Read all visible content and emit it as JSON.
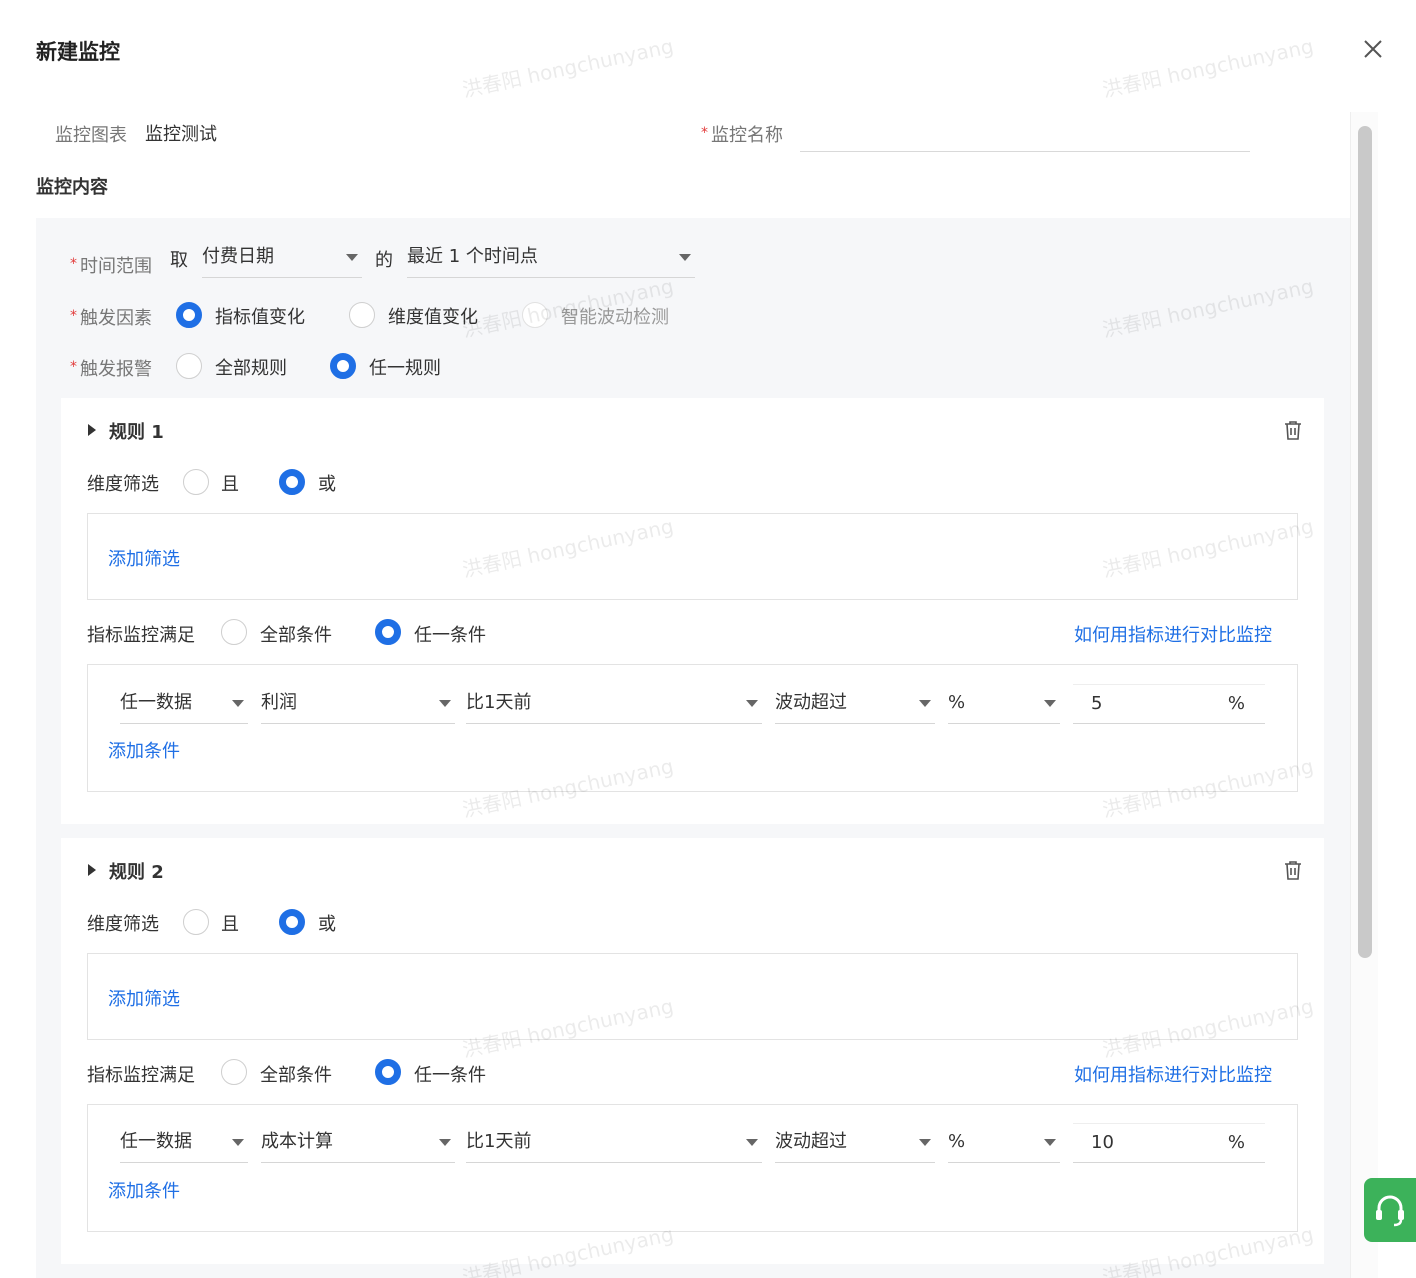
{
  "dialog": {
    "title": "新建监控"
  },
  "form": {
    "chart_label": "监控图表",
    "chart_value": "监控测试",
    "name_label": "监控名称",
    "name_value": "",
    "section_title": "监控内容",
    "time_range_label": "时间范围",
    "time_take": "取",
    "date_field": "付费日期",
    "of_text": "的",
    "time_point": "最近 1 个时间点",
    "trigger_factor_label": "触发因素",
    "trigger_options": [
      "指标值变化",
      "维度值变化",
      "智能波动检测"
    ],
    "trigger_selected": 0,
    "alarm_label": "触发报警",
    "alarm_options": [
      "全部规则",
      "任一规则"
    ],
    "alarm_selected": 1
  },
  "rules": [
    {
      "title": "规则 1",
      "dim_filter_label": "维度筛选",
      "dim_options": [
        "且",
        "或"
      ],
      "dim_selected": 1,
      "add_filter": "添加筛选",
      "metric_label": "指标监控满足",
      "metric_options": [
        "全部条件",
        "任一条件"
      ],
      "metric_selected": 1,
      "help_link": "如何用指标进行对比监控",
      "condition": {
        "scope": "任一数据",
        "metric": "利润",
        "compare": "比1天前",
        "op": "波动超过",
        "unit": "%",
        "value": "5",
        "suffix": "%"
      },
      "add_condition": "添加条件"
    },
    {
      "title": "规则 2",
      "dim_filter_label": "维度筛选",
      "dim_options": [
        "且",
        "或"
      ],
      "dim_selected": 1,
      "add_filter": "添加筛选",
      "metric_label": "指标监控满足",
      "metric_options": [
        "全部条件",
        "任一条件"
      ],
      "metric_selected": 1,
      "help_link": "如何用指标进行对比监控",
      "condition": {
        "scope": "任一数据",
        "metric": "成本计算",
        "compare": "比1天前",
        "op": "波动超过",
        "unit": "%",
        "value": "10",
        "suffix": "%"
      },
      "add_condition": "添加条件"
    }
  ],
  "watermark": "洪春阳 hongchunyang",
  "colors": {
    "accent": "#1f6fe5",
    "required": "#e23b3b",
    "panel_bg": "#f6f7f9",
    "help_button": "#3cb25a"
  },
  "icons": {
    "close": "close-icon",
    "delete": "trash-icon",
    "collapse": "caret-right-icon",
    "help": "headset-icon"
  }
}
